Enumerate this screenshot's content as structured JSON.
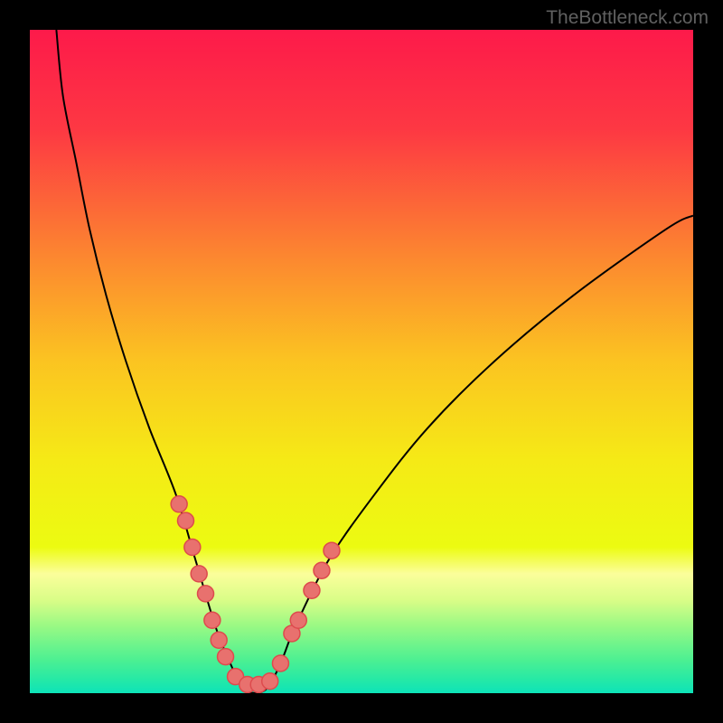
{
  "watermark": "TheBottleneck.com",
  "chart_data": {
    "type": "line",
    "title": "",
    "xlabel": "",
    "ylabel": "",
    "xlim": [
      0,
      100
    ],
    "ylim": [
      0,
      100
    ],
    "background_gradient": {
      "stops": [
        {
          "offset": 0,
          "color": "#fd1a4a"
        },
        {
          "offset": 0.15,
          "color": "#fd3843"
        },
        {
          "offset": 0.35,
          "color": "#fc8a2f"
        },
        {
          "offset": 0.5,
          "color": "#fbc421"
        },
        {
          "offset": 0.65,
          "color": "#f5ea16"
        },
        {
          "offset": 0.78,
          "color": "#ecfb11"
        },
        {
          "offset": 0.82,
          "color": "#fbfe9b"
        },
        {
          "offset": 0.86,
          "color": "#d9fd87"
        },
        {
          "offset": 0.9,
          "color": "#97f984"
        },
        {
          "offset": 0.95,
          "color": "#4cf092"
        },
        {
          "offset": 0.98,
          "color": "#25e9a6"
        },
        {
          "offset": 1,
          "color": "#0de3b9"
        }
      ]
    },
    "series": [
      {
        "name": "bottleneck-curve",
        "type": "curve",
        "color": "#000000",
        "points": [
          {
            "x": 4.0,
            "y": 100
          },
          {
            "x": 5.0,
            "y": 90
          },
          {
            "x": 7.0,
            "y": 80
          },
          {
            "x": 9.0,
            "y": 70
          },
          {
            "x": 11.5,
            "y": 60
          },
          {
            "x": 14.5,
            "y": 50
          },
          {
            "x": 18.0,
            "y": 40
          },
          {
            "x": 22.0,
            "y": 30
          },
          {
            "x": 25.0,
            "y": 20
          },
          {
            "x": 28.0,
            "y": 10
          },
          {
            "x": 30.0,
            "y": 5
          },
          {
            "x": 32.0,
            "y": 1
          },
          {
            "x": 34.0,
            "y": 0
          },
          {
            "x": 36.0,
            "y": 1
          },
          {
            "x": 38.0,
            "y": 5
          },
          {
            "x": 40.0,
            "y": 10
          },
          {
            "x": 45.0,
            "y": 20
          },
          {
            "x": 52.0,
            "y": 30
          },
          {
            "x": 60.0,
            "y": 40
          },
          {
            "x": 70.0,
            "y": 50
          },
          {
            "x": 82.0,
            "y": 60
          },
          {
            "x": 96.0,
            "y": 70
          },
          {
            "x": 100,
            "y": 72
          }
        ]
      },
      {
        "name": "data-markers",
        "type": "scatter",
        "color": "#e8716e",
        "stroke": "#dd4b4d",
        "radius": 9,
        "points": [
          {
            "x": 22.5,
            "y": 28.5
          },
          {
            "x": 23.5,
            "y": 26
          },
          {
            "x": 24.5,
            "y": 22
          },
          {
            "x": 25.5,
            "y": 18
          },
          {
            "x": 26.5,
            "y": 15
          },
          {
            "x": 27.5,
            "y": 11
          },
          {
            "x": 28.5,
            "y": 8
          },
          {
            "x": 29.5,
            "y": 5.5
          },
          {
            "x": 31.0,
            "y": 2.5
          },
          {
            "x": 32.8,
            "y": 1.3
          },
          {
            "x": 34.5,
            "y": 1.3
          },
          {
            "x": 36.2,
            "y": 1.8
          },
          {
            "x": 37.8,
            "y": 4.5
          },
          {
            "x": 39.5,
            "y": 9
          },
          {
            "x": 40.5,
            "y": 11
          },
          {
            "x": 42.5,
            "y": 15.5
          },
          {
            "x": 44.0,
            "y": 18.5
          },
          {
            "x": 45.5,
            "y": 21.5
          }
        ]
      }
    ]
  }
}
